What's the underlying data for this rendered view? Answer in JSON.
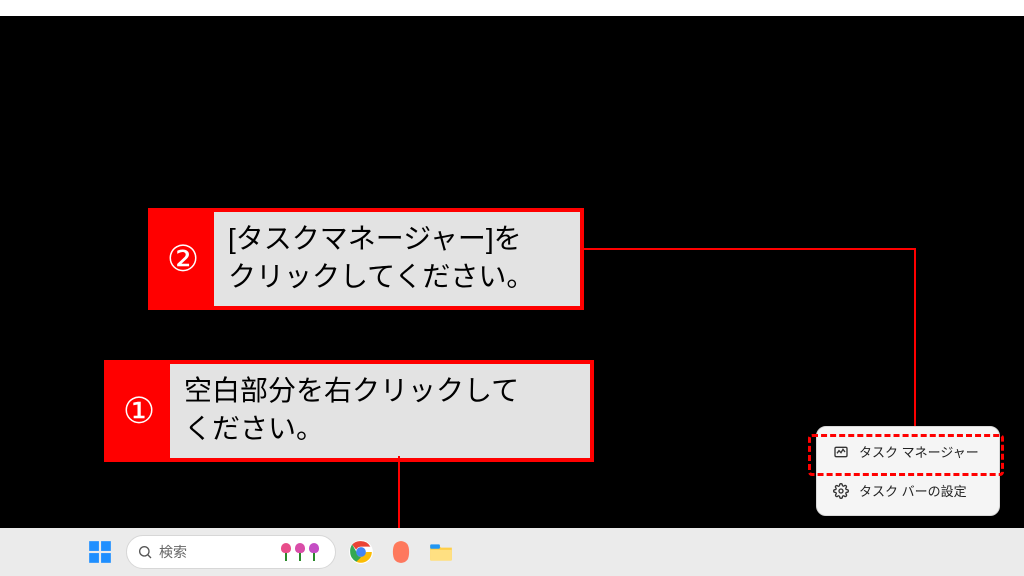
{
  "taskbar": {
    "search_placeholder": "検索",
    "icons": {
      "start": "start-icon",
      "chrome": "chrome-icon",
      "copilot": "copilot-icon",
      "explorer": "file-explorer-icon"
    }
  },
  "context_menu": {
    "task_manager_label": "タスク マネージャー",
    "taskbar_settings_label": "タスク バーの設定"
  },
  "callouts": {
    "step2_number": "②",
    "step2_text": "[タスクマネージャー]を\nクリックしてください。",
    "step1_number": "①",
    "step1_text": "空白部分を右クリックして\nください。"
  },
  "colors": {
    "accent": "#ff0000"
  }
}
